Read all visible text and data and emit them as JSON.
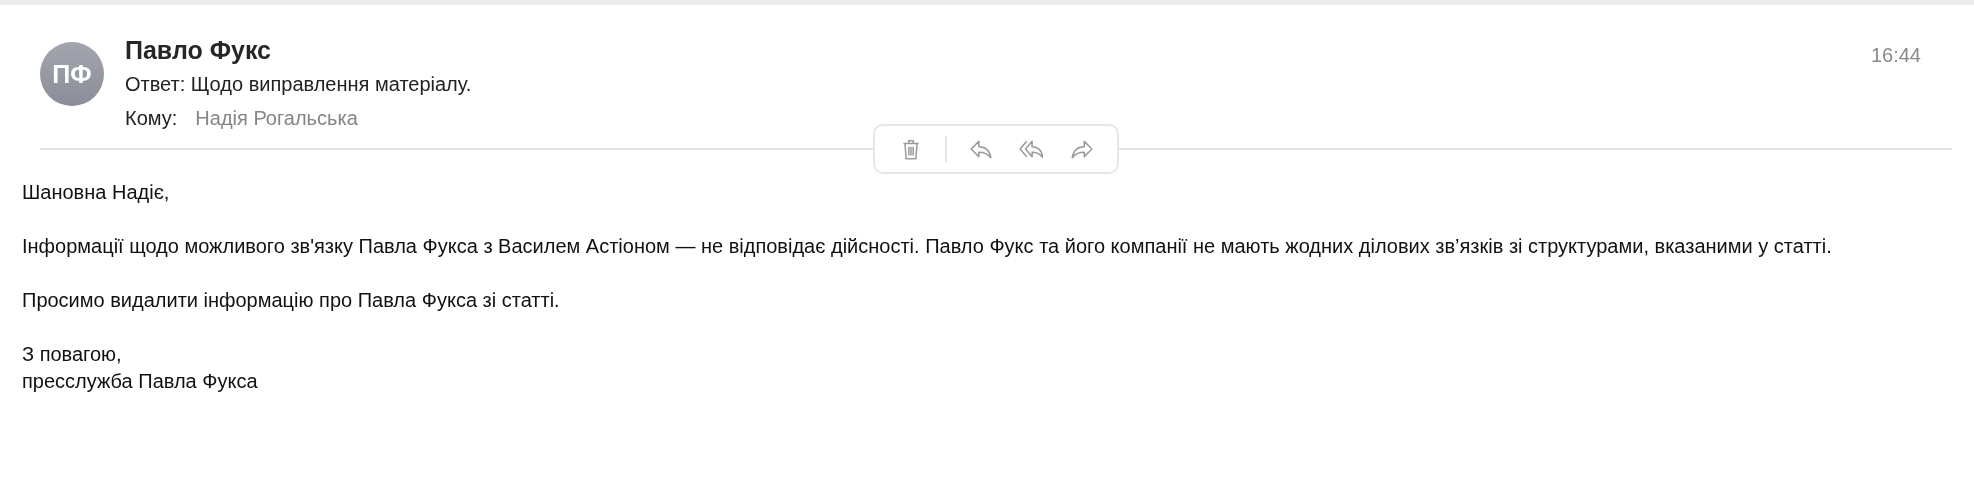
{
  "message": {
    "sender": "Павло Фукс",
    "initials": "ПФ",
    "subject": "Ответ: Щодо виправлення матеріалу.",
    "to_label": "Кому:",
    "recipient": "Надія Рогальська",
    "time": "16:44"
  },
  "toolbar": [
    {
      "kind": "delete"
    },
    {
      "kind": "reply"
    },
    {
      "kind": "reply_all"
    },
    {
      "kind": "forward"
    }
  ],
  "body": [
    {
      "lines": [
        "Шановна Надіє,"
      ]
    },
    {
      "lines": [
        "Інформації щодо можливого зв'язку Павла Фукса з Василем Астіоном — не відповідає дійсності. Павло Фукс та його компанії не мають жодних ділових зв’язків зі структурами, вказаними у статті."
      ]
    },
    {
      "lines": [
        "Просимо видалити інформацію про Павла Фукса зі статті."
      ]
    },
    {
      "lines": [
        "З повагою,",
        "пресслужба Павла Фукса"
      ]
    }
  ]
}
